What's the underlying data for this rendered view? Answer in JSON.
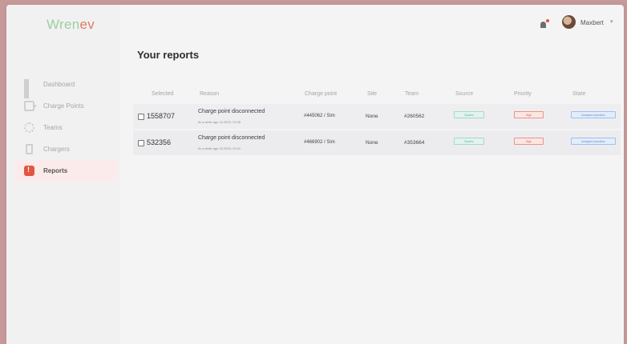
{
  "brand": {
    "part1": "Wren",
    "part2": "ev"
  },
  "sidebar": {
    "items": [
      {
        "label": "Dashboard",
        "icon": "dashboard-icon",
        "active": false
      },
      {
        "label": "Charge Points",
        "icon": "charge-point-icon",
        "active": false
      },
      {
        "label": "Teams",
        "icon": "teams-icon",
        "active": false
      },
      {
        "label": "Chargers",
        "icon": "chargers-icon",
        "active": false
      },
      {
        "label": "Reports",
        "icon": "reports-icon",
        "active": true
      }
    ]
  },
  "header": {
    "user_name": "Maxbert",
    "notification_icon": "bell-icon"
  },
  "page": {
    "title": "Your reports"
  },
  "table": {
    "columns": [
      "Selected",
      "Reason",
      "Charge point",
      "Site",
      "Team",
      "Source",
      "Priority",
      "State"
    ],
    "rows": [
      {
        "selected": "1558707",
        "reason": "Charge point disconnected",
        "reason_sub": "fix a while ago 10.2023, 23:26",
        "charge_point": "#445062 / Sim",
        "site": "None",
        "team": "#260562",
        "source": "System",
        "priority": "High",
        "state": "Assigned operation"
      },
      {
        "selected": "532356",
        "reason": "Charge point disconnected",
        "reason_sub": "fix a while ago 10.2023, 23:21",
        "charge_point": "#466902 / Sim",
        "site": "None",
        "team": "#353664",
        "source": "System",
        "priority": "High",
        "state": "Assigned operation"
      }
    ]
  },
  "colors": {
    "brand_green": "#9ccf9e",
    "brand_orange": "#e07b67",
    "active_nav_bg": "#fbeceb",
    "source_badge": "#5eb493",
    "priority_badge": "#d9634a",
    "state_badge": "#5a8ed1"
  }
}
